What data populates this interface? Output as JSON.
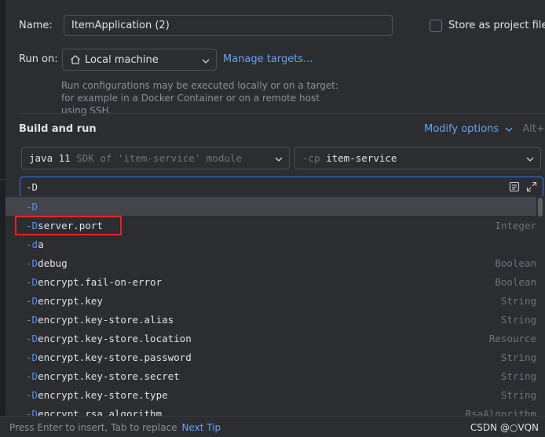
{
  "name": {
    "label": "Name:",
    "value": "ItemApplication (2)"
  },
  "store_project": {
    "label": "Store as project file",
    "checked": false
  },
  "run_on": {
    "label": "Run on:",
    "target": "Local machine",
    "manage_link": "Manage targets...",
    "description": "Run configurations may be executed locally or on a target: for example in a Docker Container or on a remote host using SSH."
  },
  "build_run": {
    "title": "Build and run",
    "modify_label": "Modify options",
    "modify_shortcut": "Alt+M",
    "sdk": {
      "main": "java 11",
      "detail": "SDK of 'item-service' module"
    },
    "classpath": {
      "flag": "-cp",
      "module": "item-service"
    },
    "vm_options_value": "-D"
  },
  "completion": {
    "items": [
      {
        "prefix": "-D",
        "rest": "",
        "type": ""
      },
      {
        "prefix": "-D",
        "rest": "server.port",
        "type": "Integer"
      },
      {
        "prefix": "-d",
        "rest": "a",
        "type": ""
      },
      {
        "prefix": "-D",
        "rest": "debug",
        "type": "Boolean"
      },
      {
        "prefix": "-D",
        "rest": "encrypt.fail-on-error",
        "type": "Boolean"
      },
      {
        "prefix": "-D",
        "rest": "encrypt.key",
        "type": "String"
      },
      {
        "prefix": "-D",
        "rest": "encrypt.key-store.alias",
        "type": "String"
      },
      {
        "prefix": "-D",
        "rest": "encrypt.key-store.location",
        "type": "Resource"
      },
      {
        "prefix": "-D",
        "rest": "encrypt.key-store.password",
        "type": "String"
      },
      {
        "prefix": "-D",
        "rest": "encrypt.key-store.secret",
        "type": "String"
      },
      {
        "prefix": "-D",
        "rest": "encrypt.key-store.type",
        "type": "String"
      },
      {
        "prefix": "-D",
        "rest": "encrypt.rsa.algorithm",
        "type": "RsaAlgorithm"
      }
    ]
  },
  "footer": {
    "hint": "Press Enter to insert, Tab to replace",
    "tip": "Next Tip",
    "watermark": "CSDN @○VQN"
  },
  "colors": {
    "accent": "#3574f0",
    "link": "#6aa1f5",
    "highlight_box": "#e0262a"
  }
}
